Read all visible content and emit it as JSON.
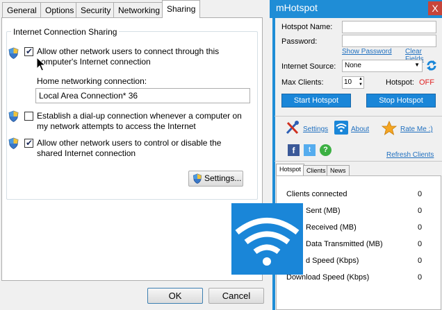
{
  "dialog": {
    "tabs": [
      "General",
      "Options",
      "Security",
      "Networking",
      "Sharing"
    ],
    "active_tab": "Sharing",
    "group_title": "Internet Connection Sharing",
    "allow_connect": {
      "checked": true,
      "line1": "Allow other network users to connect through this",
      "line2": "computer's Internet connection"
    },
    "home_label": "Home networking connection:",
    "home_value": "Local Area Connection* 36",
    "dialup": {
      "checked": false,
      "line1": "Establish a dial-up connection whenever a computer on",
      "line2": "my network attempts to access the Internet"
    },
    "allow_control": {
      "checked": true,
      "line1": "Allow other network users to control or disable the",
      "line2": "shared Internet connection"
    },
    "settings_button": "Settings...",
    "ok_button": "OK",
    "cancel_button": "Cancel"
  },
  "app": {
    "title": "mHotspot",
    "close_glyph": "X",
    "hotspot_name_label": "Hotspot Name:",
    "hotspot_name_value": "",
    "password_label": "Password:",
    "password_value": "",
    "show_password": "Show Password",
    "clear_fields": "Clear Fields",
    "internet_source_label": "Internet Source:",
    "internet_source_value": "None",
    "max_clients_label": "Max Clients:",
    "max_clients_value": "10",
    "hotspot_status_label": "Hotspot:",
    "hotspot_status_value": "OFF",
    "start_button": "Start Hotspot",
    "stop_button": "Stop Hotspot",
    "settings_link": "Settings",
    "about_link": "About",
    "rate_link": "Rate Me :)",
    "refresh_link": "Refresh Clients",
    "tabs": [
      "Hotspot",
      "Clients",
      "News"
    ],
    "active_tab": "Hotspot",
    "stats": [
      {
        "label": "Clients connected",
        "value": "0"
      },
      {
        "label": "Sent (MB)",
        "value": "0"
      },
      {
        "label": "Received (MB)",
        "value": "0"
      },
      {
        "label": "Data Transmitted (MB)",
        "value": "0"
      },
      {
        "label": "d Speed (Kbps)",
        "value": "0"
      },
      {
        "label": "Download Speed (Kbps)",
        "value": "0"
      }
    ]
  },
  "colors": {
    "accent": "#1f8dd6",
    "button_blue": "#1a86d8",
    "status_off": "#e02020",
    "link": "#1f6fbf"
  }
}
